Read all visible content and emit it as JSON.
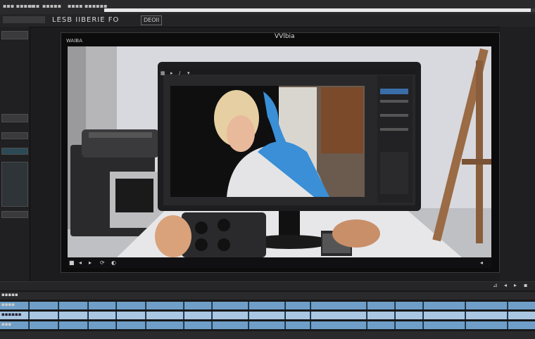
{
  "app": {
    "menu_items": [
      "▪▪▪ ▪▪▪▪▪",
      "▪▪▪",
      "▪▪▪▪▪",
      "▪▪▪▪",
      "▪▪▪▪▪▪"
    ],
    "progress_fraction": 0.99
  },
  "toolbar": {
    "title_text": "LESB IIBERIE  FO",
    "box_text": "DEOII"
  },
  "viewer": {
    "title": "VVlbia",
    "corner_label": "WAIBA",
    "control_icons": [
      "■",
      "◂",
      "▸",
      "⟳",
      "◐"
    ],
    "end_icon": "◂"
  },
  "inner_monitor": {
    "toolbar_icons": [
      "▦",
      "▸",
      "/",
      "▾"
    ]
  },
  "colors": {
    "accent_blue": "#3a8fd6",
    "clip_blue": "#6f9fc8",
    "clip_light": "#a9c6e2",
    "panel_dark": "#1c1c1e"
  },
  "timeline": {
    "track_labels": [
      "▪▪▪▪▪",
      "▪▪▪▪",
      "▪▪▪▪▪▪",
      "▪▪▪"
    ],
    "icons": [
      "⊿",
      "◂",
      "▸",
      "▪"
    ]
  }
}
